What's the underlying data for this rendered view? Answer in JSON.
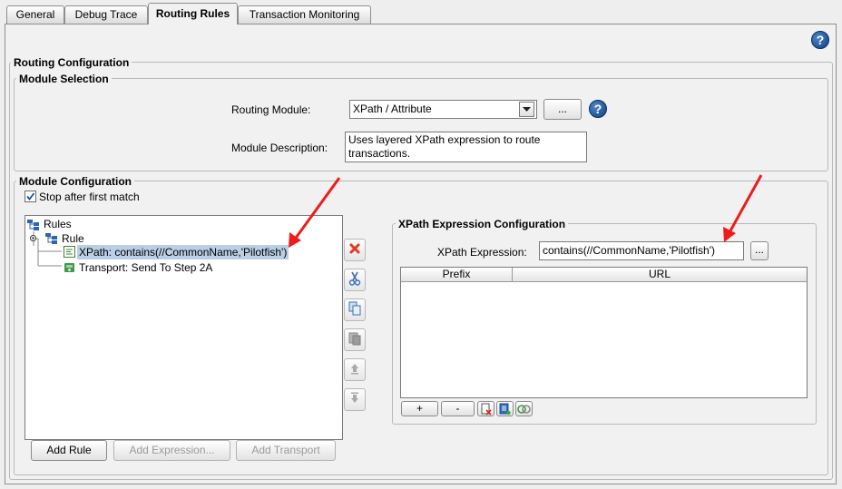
{
  "tabs": [
    {
      "label": "General"
    },
    {
      "label": "Debug Trace"
    },
    {
      "label": "Routing Rules"
    },
    {
      "label": "Transaction Monitoring"
    }
  ],
  "help_glyph": "?",
  "routing_config": {
    "title": "Routing Configuration"
  },
  "module_selection": {
    "title": "Module Selection",
    "routing_module_label": "Routing Module:",
    "routing_module_value": "XPath / Attribute",
    "browse_label": "...",
    "description_label": "Module Description:",
    "description_value": "Uses layered XPath expression to route transactions."
  },
  "module_config": {
    "title": "Module Configuration",
    "stop_after_first_match": {
      "label": "Stop after first match",
      "checked": true
    },
    "tree": {
      "root": "Rules",
      "rule": "Rule",
      "xpath_item": "XPath: contains(//CommonName,'Pilotfish')",
      "transport_item": "Transport: Send To Step 2A"
    },
    "buttons": {
      "add_rule": "Add Rule",
      "add_expression": "Add Expression...",
      "add_transport": "Add Transport"
    }
  },
  "xpath_config": {
    "title": "XPath Expression Configuration",
    "expression_label": "XPath Expression:",
    "expression_value": "contains(//CommonName,'Pilotfish')",
    "browse_label": "...",
    "columns": [
      "Prefix",
      "URL"
    ],
    "add_label": "+",
    "remove_label": "-"
  },
  "colors": {
    "accent": "#0e3f83",
    "selection": "#b8cfe5",
    "arrow": "#ee1c1c"
  }
}
